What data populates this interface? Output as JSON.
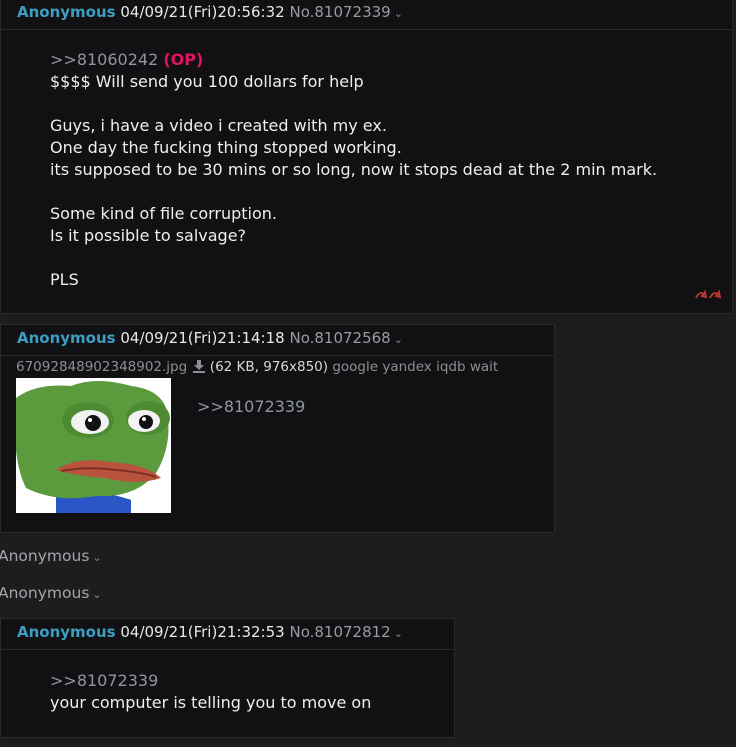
{
  "posts": [
    {
      "name": "Anonymous",
      "datetime": "04/09/21(Fri)20:56:32",
      "number": "No.81072339",
      "quote": ">>81060242",
      "op_tag": "(OP)",
      "text": "$$$$ Will send you 100 dollars for help\n\nGuys, i have a video i created with my ex.\nOne day the fucking thing stopped working.\nits supposed to be 30 mins or so long, now it stops dead at the 2 min mark.\n\nSome kind of file corruption.\nIs it possible to salvage?\n\nPLS"
    },
    {
      "name": "Anonymous",
      "datetime": "04/09/21(Fri)21:14:18",
      "number": "No.81072568",
      "file_name": "67092848902348902.jpg",
      "file_meta": "(62 KB, 976x850)",
      "file_links": "google yandex iqdb wait",
      "quote": ">>81072339"
    },
    {
      "name": "Anonymous",
      "datetime": "04/09/21(Fri)21:32:53",
      "number": "No.81072812",
      "quote": ">>81072339",
      "text": "your computer is telling you to move on"
    }
  ],
  "hidden_posts": [
    {
      "name": "Anonymous"
    },
    {
      "name": "Anonymous"
    }
  ],
  "icons": {
    "chevron": "chevron-down-icon",
    "download": "download-icon",
    "backlink": "reply-arrow-icon"
  },
  "colors": {
    "name": "#3d9ec2",
    "op": "#e0145f",
    "backlink": "#c0392b",
    "background": "#1d1d1f",
    "post_bg": "#111113"
  }
}
